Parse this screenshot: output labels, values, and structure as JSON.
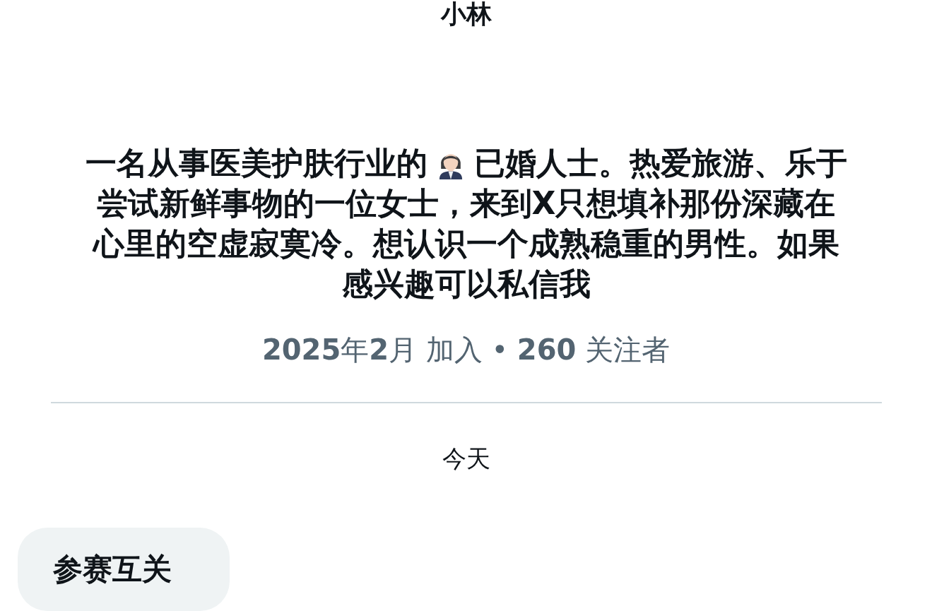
{
  "profile": {
    "name": "小林",
    "bio": {
      "before_icon": "一名从事医美护肤行业的",
      "after_icon": "已婚人士。热爱旅游、乐于",
      "lines": [
        "尝试新鲜事物的一位女士，来到X只想填补那份深藏在",
        "心里的空虚寂寞冷。想认识一个成熟稳重的男性。如果",
        "感兴趣可以私信我"
      ]
    },
    "meta": "**2025**年**2**月 加入 • **260** 关注者"
  },
  "date_separator": "今天",
  "messages": [
    {
      "text": "参赛互关"
    }
  ]
}
